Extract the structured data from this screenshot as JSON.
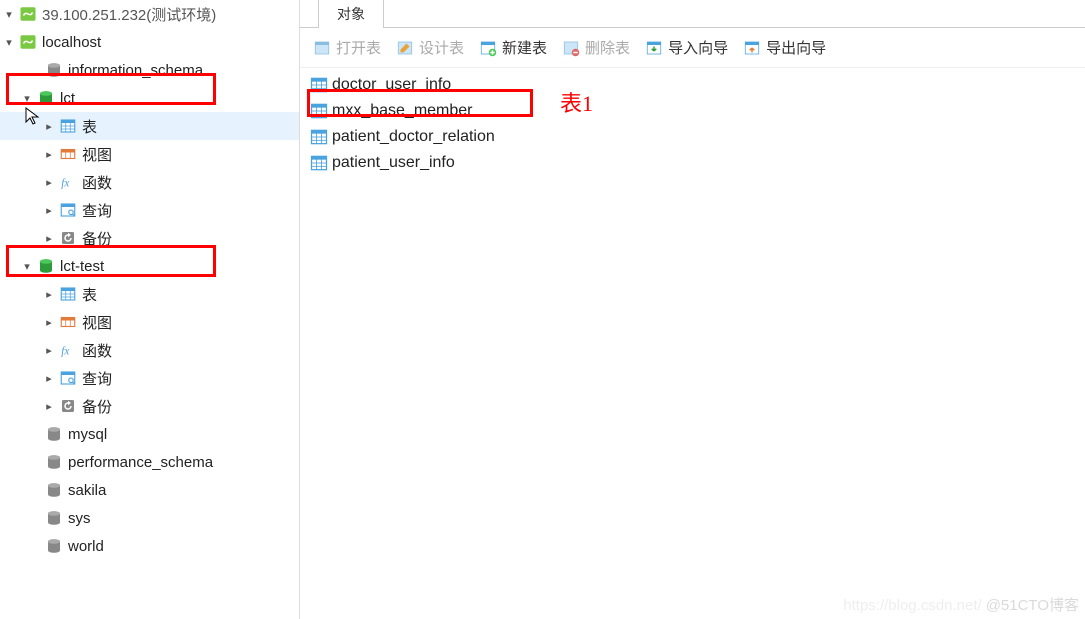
{
  "sidebar": {
    "conn1": {
      "name": "39.100.251.232(测试环境)"
    },
    "conn2": {
      "name": "localhost"
    },
    "dbs": {
      "info_schema": "information_schema",
      "lct": "lct",
      "lct_test": "lct-test",
      "mysql": "mysql",
      "perf_schema": "performance_schema",
      "sakila": "sakila",
      "sys": "sys",
      "world": "world"
    },
    "nodes": {
      "tables": "表",
      "views": "视图",
      "functions": "函数",
      "queries": "查询",
      "backup": "备份"
    }
  },
  "tab": {
    "label": "对象"
  },
  "toolbar": {
    "open": "打开表",
    "design": "设计表",
    "new": "新建表",
    "delete": "删除表",
    "import": "导入向导",
    "export": "导出向导"
  },
  "tables": [
    "doctor_user_info",
    "mxx_base_member",
    "patient_doctor_relation",
    "patient_user_info"
  ],
  "annotation": {
    "label": "表1"
  },
  "watermark": {
    "left": "https://blog.csdn.net/",
    "right": "@51CTO博客"
  }
}
